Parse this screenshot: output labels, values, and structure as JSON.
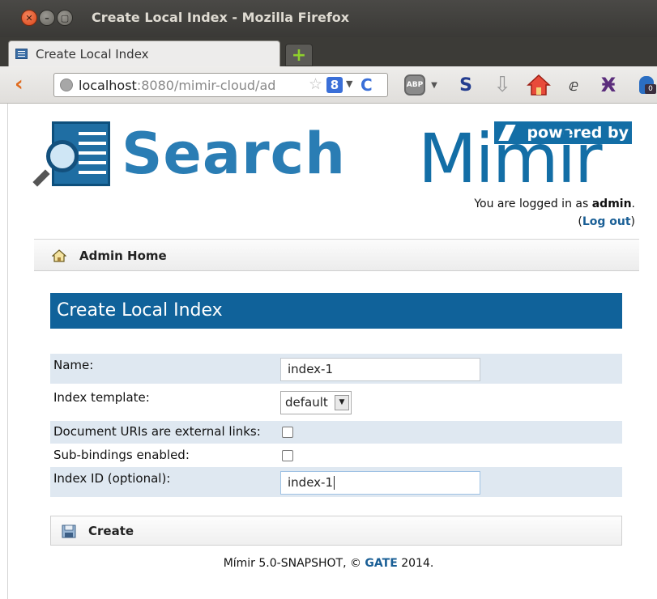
{
  "window": {
    "title": "Create Local Index - Mozilla Firefox",
    "close_glyph": "✕",
    "minimize_glyph": "–",
    "maximize_glyph": "▢"
  },
  "tabs": [
    {
      "label": "Create Local Index",
      "icon": "page-icon",
      "active": true
    }
  ],
  "new_tab": {
    "glyph": "+",
    "color": "#8fd12c"
  },
  "navbar": {
    "back_glyph": "‹",
    "url_host": "localhost",
    "url_rest": ":8080/mimir-cloud/ad",
    "search_engine_glyph": "8",
    "reload_glyph": "C",
    "toolbar_icons": [
      "adblock-plus-icon",
      "s-icon",
      "download-icon",
      "home-icon",
      "cookie-icon",
      "xpath-icon",
      "extension-icon"
    ],
    "abp_label": "ABP",
    "s_glyph": "S",
    "download_glyph": "⇩",
    "cookie_glyph": "ⅇ",
    "xpath_glyph": "Ӿ",
    "extension_badge": "0"
  },
  "header": {
    "logo_text": "Search",
    "powered_by": "powered by",
    "brand_text": "Mimir",
    "login_prefix": "You are logged in as ",
    "login_user": "admin",
    "login_suffix": ".",
    "logout_open": "(",
    "logout_label": "Log out",
    "logout_close": ")"
  },
  "admin_bar": {
    "label": "Admin Home"
  },
  "section": {
    "title": "Create Local Index"
  },
  "form": {
    "name_label": "Name:",
    "name_value": "index-1",
    "template_label": "Index template:",
    "template_value": "default",
    "docuri_label": "Document URIs are external links:",
    "docuri_checked": false,
    "subbind_label": "Sub-bindings enabled:",
    "subbind_checked": false,
    "indexid_label": "Index ID (optional):",
    "indexid_value": "index-1"
  },
  "create_button": {
    "label": "Create"
  },
  "footer": {
    "prefix": "Mímir 5.0-SNAPSHOT, © ",
    "link": "GATE",
    "suffix": " 2014."
  },
  "colors": {
    "brand_blue": "#10629a",
    "logo_blue": "#2a7db4",
    "link_blue": "#1a5f96",
    "row_shade": "#dfe8f1"
  }
}
